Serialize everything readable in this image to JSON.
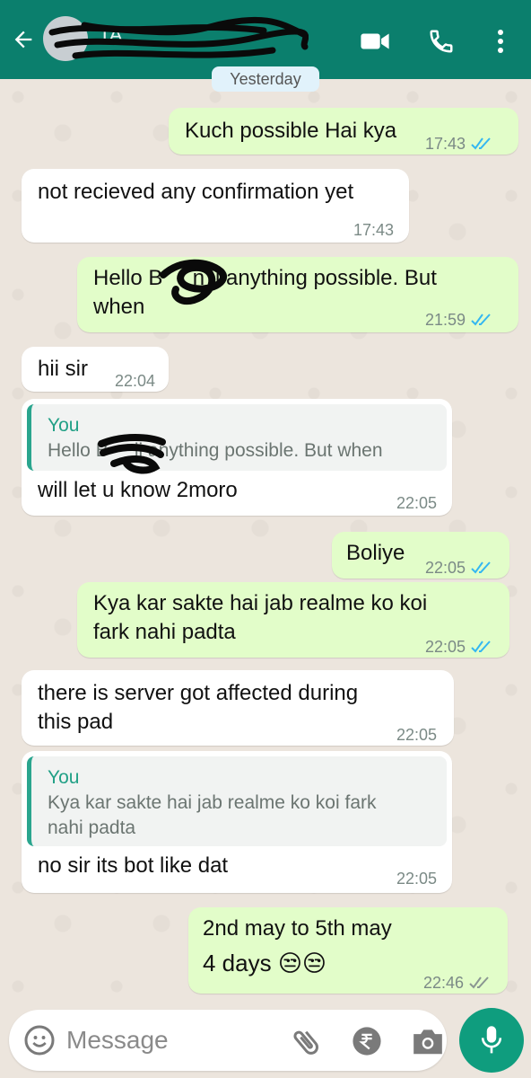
{
  "header": {
    "contact_name": "TA",
    "icons": [
      "back-arrow-icon",
      "video-call-icon",
      "phone-icon",
      "more-vert-icon"
    ]
  },
  "date_chip": "Yesterday",
  "messages": [
    {
      "dir": "out",
      "text": "Kuch possible Hai kya",
      "time": "17:43",
      "status": "read"
    },
    {
      "dir": "in",
      "text": "not recieved any confirmation yet",
      "time": "17:43"
    },
    {
      "dir": "out",
      "text": "Hello B     n ji anything possible. But when",
      "line1": "Hello B     n ji anything possible. But",
      "line2": "when",
      "time": "21:59",
      "status": "read"
    },
    {
      "dir": "in",
      "text": "hii sir",
      "time": "22:04"
    },
    {
      "dir": "in",
      "quote_author": "You",
      "quote_text": "Hello B     ji anything possible. But when",
      "text": "will let u know 2moro",
      "time": "22:05"
    },
    {
      "dir": "out",
      "text": "Boliye",
      "time": "22:05",
      "status": "read"
    },
    {
      "dir": "out",
      "text": "Kya kar sakte hai jab realme ko koi fark nahi padta",
      "line1": "Kya kar sakte hai jab realme ko koi",
      "line2": "fark nahi padta",
      "time": "22:05",
      "status": "read"
    },
    {
      "dir": "in",
      "text": "there is server got affected during this pad",
      "line1": "there is server got affected during",
      "line2": "this pad",
      "time": "22:05"
    },
    {
      "dir": "in",
      "quote_author": "You",
      "quote_text": "Kya kar sakte hai jab realme ko koi fark nahi padta",
      "quote_line1": "Kya kar sakte hai jab realme ko koi fark",
      "quote_line2": "nahi padta",
      "text": "no sir its bot like dat",
      "time": "22:05"
    },
    {
      "dir": "out",
      "line1": "2nd may to 5th may",
      "line2": "4 days 😒😒",
      "time": "22:46",
      "status": "delivered"
    }
  ],
  "composer": {
    "placeholder": "Message",
    "icons": [
      "emoji-icon",
      "attach-icon",
      "rupee-payment-icon",
      "camera-icon",
      "mic-icon"
    ]
  },
  "colors": {
    "header": "#0b7f6d",
    "outgoing_bubble": "#e2fdc9",
    "incoming_bubble": "#ffffff",
    "read_ticks": "#34b7f1",
    "mic_button": "#0f9d7e"
  }
}
